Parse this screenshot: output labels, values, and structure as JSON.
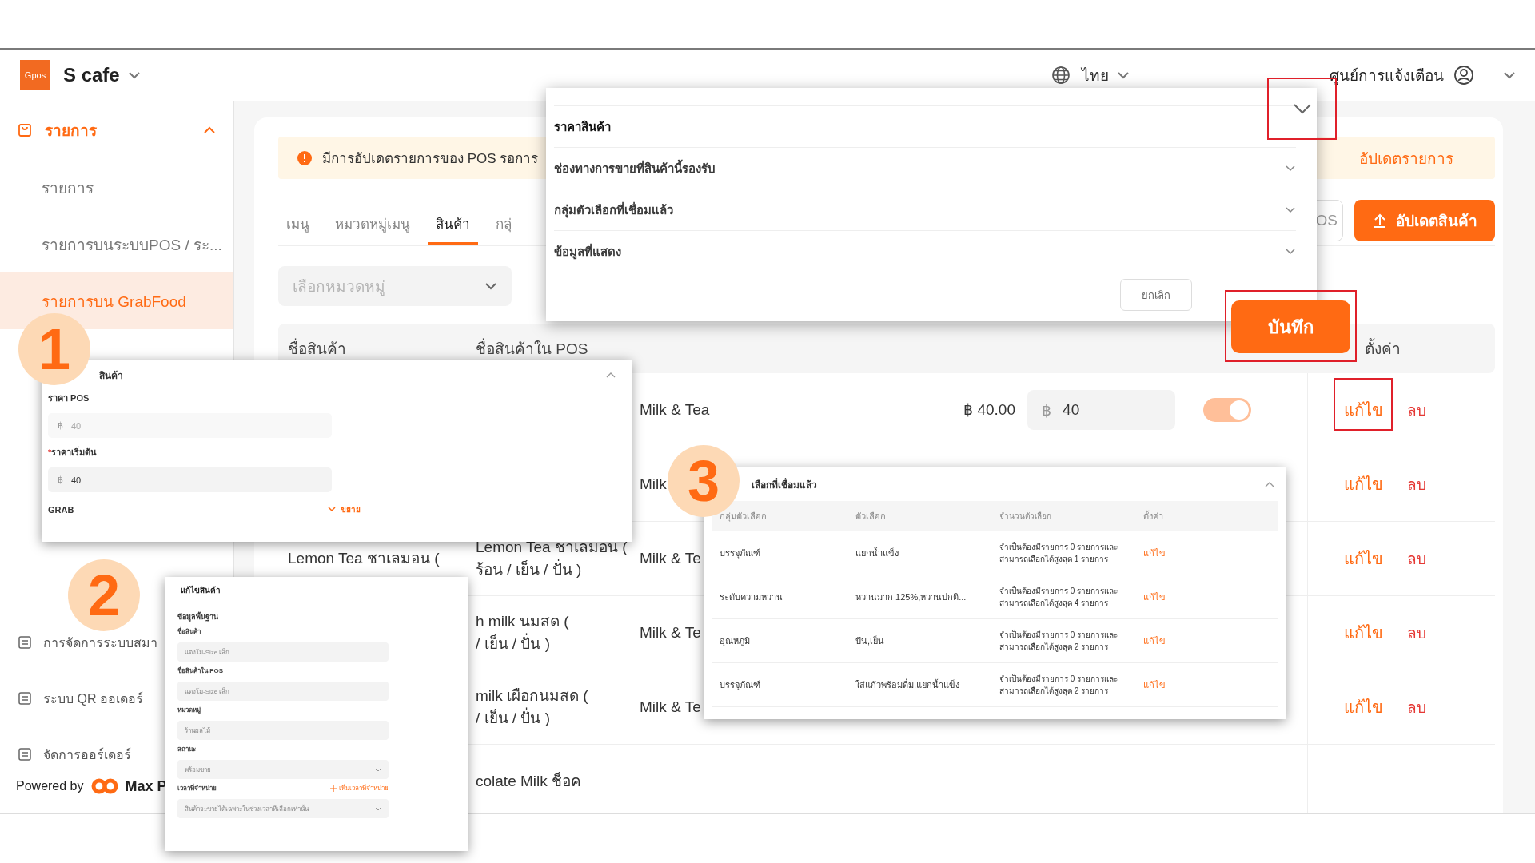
{
  "header": {
    "logo": "Gpos",
    "store_name": "S cafe",
    "language": "ไทย",
    "notifications": "ศูนย์การแจ้งเตือน"
  },
  "sidebar": {
    "group": {
      "label": "รายการ",
      "expanded": true,
      "items": [
        {
          "label": "รายการ",
          "selected": false
        },
        {
          "label": "รายการบนระบบPOS / ระ...",
          "selected": false
        },
        {
          "label": "รายการบน GrabFood",
          "selected": true
        }
      ]
    },
    "items": [
      {
        "label": "การจัดการระบบสมา"
      },
      {
        "label": "ระบบ QR ออเดอร์"
      },
      {
        "label": "จัดการออร์เดอร์"
      }
    ],
    "powered_by": "Powered by",
    "brand": "Max P"
  },
  "banner": {
    "message": "มีการอัปเดตรายการของ POS รอการ",
    "action": "อัปเดตรายการ"
  },
  "tabs": [
    {
      "label": "เมนู",
      "selected": false
    },
    {
      "label": "หมวดหมู่เมนู",
      "selected": false
    },
    {
      "label": "สินค้า",
      "selected": true
    },
    {
      "label": "กลุ่",
      "selected": false
    }
  ],
  "toolbar": {
    "pos_button": "OS",
    "update_button": "อัปเดตสินค้า"
  },
  "filter": {
    "placeholder": "เลือกหมวดหมู่"
  },
  "table": {
    "columns": {
      "name": "ชื่อสินค้า",
      "pos_name": "ชื่อสินค้าใน POS",
      "settings": "ตั้งค่า"
    },
    "rows": [
      {
        "category": "Milk & Tea",
        "pos_price": "฿ 40.00",
        "currency": "฿",
        "start_price": "40",
        "on": true,
        "edit": "แก้ไข",
        "delete": "ลบ"
      },
      {
        "category": "Milk",
        "edit": "แก้ไข",
        "delete": "ลบ"
      },
      {
        "name": [
          "Lemon Tea ชาเลมอน ("
        ],
        "pos_name": [
          "Lemon Tea ชาเลมอน (",
          "ร้อน / เย็น / ปั่น )"
        ],
        "category": "Milk & Te",
        "edit": "แก้ไข",
        "delete": "ลบ"
      },
      {
        "pos_name": [
          "h milk นมสด (",
          "/ เย็น / ปั่น )"
        ],
        "category": "Milk & Te",
        "edit": "แก้ไข",
        "delete": "ลบ"
      },
      {
        "pos_name": [
          "milk เผือกนมสด (",
          "/ เย็น / ปั่น )"
        ],
        "category": "Milk & Te",
        "edit": "แก้ไข",
        "delete": "ลบ"
      },
      {
        "pos_name": [
          "colate Milk ช็อค"
        ]
      }
    ]
  },
  "modal": {
    "sections": [
      {
        "label": "ราคาสินค้า",
        "expanded": true
      },
      {
        "label": "ช่องทางการขายที่สินค้านี้รองรับ",
        "expanded": false
      },
      {
        "label": "กลุ่มตัวเลือกที่เชื่อมแล้ว",
        "expanded": false
      },
      {
        "label": "ข้อมูลที่แสดง",
        "expanded": false
      }
    ],
    "cancel": "ยกเลิก",
    "save": "บันทึก"
  },
  "price_panel": {
    "title": "สินค้า",
    "fields": [
      {
        "label": "ราคา POS",
        "prefix": "฿",
        "value": "40",
        "disabled": true
      },
      {
        "mark": "*",
        "label": "ราคาเริ่มต้น",
        "prefix": "฿",
        "value": "40",
        "disabled": false
      }
    ],
    "channel": "GRAB",
    "expand": "ขยาย"
  },
  "edit_panel": {
    "title": "แก้ไขสินค้า",
    "section": "ข้อมูลพื้นฐาน",
    "fields": [
      {
        "kind": "input",
        "label": "ชื่อสินค้า",
        "placeholder": "แตงโม-Size เล็ก"
      },
      {
        "kind": "input",
        "label": "ชื่อสินค้าใน POS",
        "placeholder": "แตงโม-Size เล็ก"
      },
      {
        "kind": "input",
        "label": "หมวดหมู่",
        "placeholder": "ร้านผลไม้"
      },
      {
        "kind": "select",
        "label": "สถานะ",
        "placeholder": "พร้อมขาย"
      },
      {
        "kind": "select",
        "label": "เวลาที่จำหน่าย",
        "action": "เพิ่มเวลาที่จำหน่าย",
        "placeholder": "สินค้าจะขายได้เฉพาะในช่วงเวลาที่เลือกเท่านั้น"
      }
    ]
  },
  "options_panel": {
    "title": "เลือกที่เชื่อมแล้ว",
    "columns": [
      "กลุ่มตัวเลือก",
      "ตัวเลือก",
      "จำนวนตัวเลือก",
      "ตั้งค่า"
    ],
    "rows": [
      {
        "group": "บรรจุภัณฑ์",
        "options": "แยกน้ำแข็ง",
        "count": [
          "จำเป็นต้องมีรายการ 0 รายการและ",
          "สามารถเลือกได้สูงสุด 1 รายการ"
        ],
        "action": "แก้ไข"
      },
      {
        "group": "ระดับความหวาน",
        "options": "หวานมาก 125%,หวานปกติ...",
        "count": [
          "จำเป็นต้องมีรายการ 0 รายการและ",
          "สามารถเลือกได้สูงสุด 4 รายการ"
        ],
        "action": "แก้ไข"
      },
      {
        "group": "อุณหภูมิ",
        "options": "ปั่น,เย็น",
        "count": [
          "จำเป็นต้องมีรายการ 0 รายการและ",
          "สามารถเลือกได้สูงสุด 2 รายการ"
        ],
        "action": "แก้ไข"
      },
      {
        "group": "บรรจุภัณฑ์",
        "options": "ใส่แก้วพร้อมดื่ม,แยกน้ำแข็ง",
        "count": [
          "จำเป็นต้องมีรายการ 0 รายการและ",
          "สามารถเลือกได้สูงสุด 2 รายการ"
        ],
        "action": "แก้ไข"
      }
    ]
  },
  "steps": [
    "1",
    "2",
    "3"
  ]
}
